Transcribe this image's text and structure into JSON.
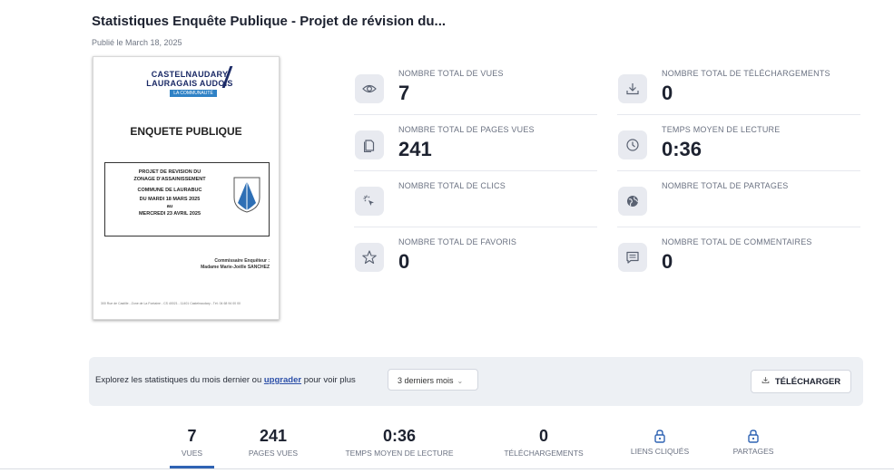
{
  "page": {
    "title": "Statistiques Enquête Publique - Projet de révision du...",
    "published": "Publié le March 18, 2025"
  },
  "document": {
    "logo_line1": "CASTELNAUDARY",
    "logo_line2": "LAURAGAIS AUDOIS",
    "logo_tag": "LA COMMUNAUTÉ",
    "heading": "ENQUETE PUBLIQUE",
    "box_lines": [
      "PROJET DE REVISION DU",
      "ZONAGE D'ASSAINISSEMENT",
      "COMMUNE DE LAURABUC",
      "DU MARDI 18 MARS 2025",
      "au",
      "MERCREDI 23 AVRIL 2025"
    ],
    "signer_line1": "Commissaire Enquêteur :",
    "signer_line2": "Madame Marie-Joëlle SANCHEZ",
    "footer": "300 Rue de Castille - Zone de La Fontaine - CS 40021 - 11401 Castelnaudary - Tél. 04 68 94 00 00"
  },
  "stats": [
    {
      "label": "NOMBRE TOTAL DE VUES",
      "value": "7",
      "icon": "eye-icon"
    },
    {
      "label": "NOMBRE TOTAL DE TÉLÉCHARGEMENTS",
      "value": "0",
      "icon": "download-icon"
    },
    {
      "label": "NOMBRE TOTAL DE PAGES VUES",
      "value": "241",
      "icon": "pages-icon"
    },
    {
      "label": "TEMPS MOYEN DE LECTURE",
      "value": "0:36",
      "icon": "clock-icon"
    },
    {
      "label": "NOMBRE TOTAL DE CLICS",
      "value": "",
      "icon": "click-icon"
    },
    {
      "label": "NOMBRE TOTAL DE PARTAGES",
      "value": "",
      "icon": "globe-icon"
    },
    {
      "label": "NOMBRE TOTAL DE FAVORIS",
      "value": "0",
      "icon": "star-icon"
    },
    {
      "label": "NOMBRE TOTAL DE COMMENTAIRES",
      "value": "0",
      "icon": "comment-icon"
    }
  ],
  "filter": {
    "text_before": "Explorez les statistiques du mois dernier ou ",
    "link": "upgrader",
    "text_after": " pour voir plus",
    "period": "3 derniers mois",
    "download": "TÉLÉCHARGER"
  },
  "tabs": [
    {
      "value": "7",
      "label": "VUES"
    },
    {
      "value": "241",
      "label": "PAGES VUES"
    },
    {
      "value": "0:36",
      "label": "TEMPS MOYEN DE LECTURE"
    },
    {
      "value": "0",
      "label": "TÉLÉCHARGEMENTS"
    },
    {
      "value": "",
      "label": "LIENS CLIQUÉS",
      "icon": "lock-icon"
    },
    {
      "value": "",
      "label": "PARTAGES",
      "icon": "lock-icon"
    }
  ],
  "colors": {
    "accent": "#2f63b3",
    "link": "#2c4fa8",
    "icon_bg": "#e8eaf0",
    "bar_bg": "#edf0f4"
  }
}
